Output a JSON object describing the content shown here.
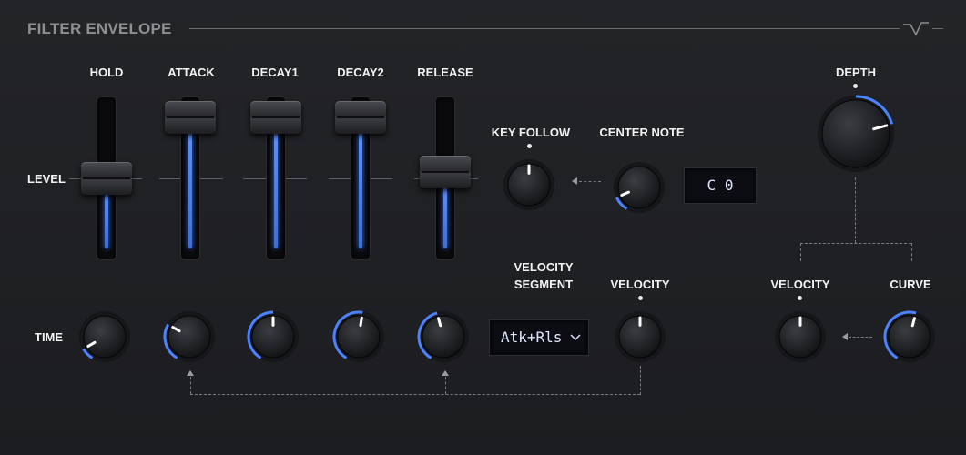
{
  "panel": {
    "title": "FILTER ENVELOPE",
    "icons": [
      "envelope-shape-icon",
      "dropdown-chevron-icon"
    ]
  },
  "row_labels": {
    "level": "LEVEL",
    "time": "TIME"
  },
  "sliders": [
    {
      "id": "hold",
      "label": "HOLD",
      "level": 0.5
    },
    {
      "id": "attack",
      "label": "ATTACK",
      "level": 1.0
    },
    {
      "id": "decay1",
      "label": "DECAY1",
      "level": 1.0
    },
    {
      "id": "decay2",
      "label": "DECAY2",
      "level": 1.0
    },
    {
      "id": "release",
      "label": "RELEASE",
      "level": 0.55
    }
  ],
  "time_knobs": [
    {
      "id": "hold",
      "value": 0.1,
      "bipolar": false
    },
    {
      "id": "attack",
      "value": 0.3,
      "bipolar": false
    },
    {
      "id": "decay1",
      "value": 0.5,
      "bipolar": false
    },
    {
      "id": "decay2",
      "value": 0.53,
      "bipolar": false
    },
    {
      "id": "release",
      "value": 0.45,
      "bipolar": false
    }
  ],
  "key_follow": {
    "label": "KEY FOLLOW",
    "value": 0.5,
    "bipolar": true
  },
  "center_note": {
    "label": "CENTER NOTE",
    "value": 0.12,
    "display": "C 0"
  },
  "velocity_segment": {
    "label_line1": "VELOCITY",
    "label_line2": "SEGMENT",
    "selected": "Atk+Rls"
  },
  "segment_velocity": {
    "label": "VELOCITY",
    "value": 0.5,
    "bipolar": true
  },
  "depth": {
    "label": "DEPTH",
    "value": 0.75,
    "bipolar": true
  },
  "depth_velocity": {
    "label": "VELOCITY",
    "value": 0.5,
    "bipolar": true
  },
  "curve": {
    "label": "CURVE",
    "value": 0.55,
    "bipolar": false
  },
  "colors": {
    "accent": "#4a82ff",
    "background": "#1f2023",
    "label": "#f2f2f2",
    "title": "#8e8f93"
  }
}
